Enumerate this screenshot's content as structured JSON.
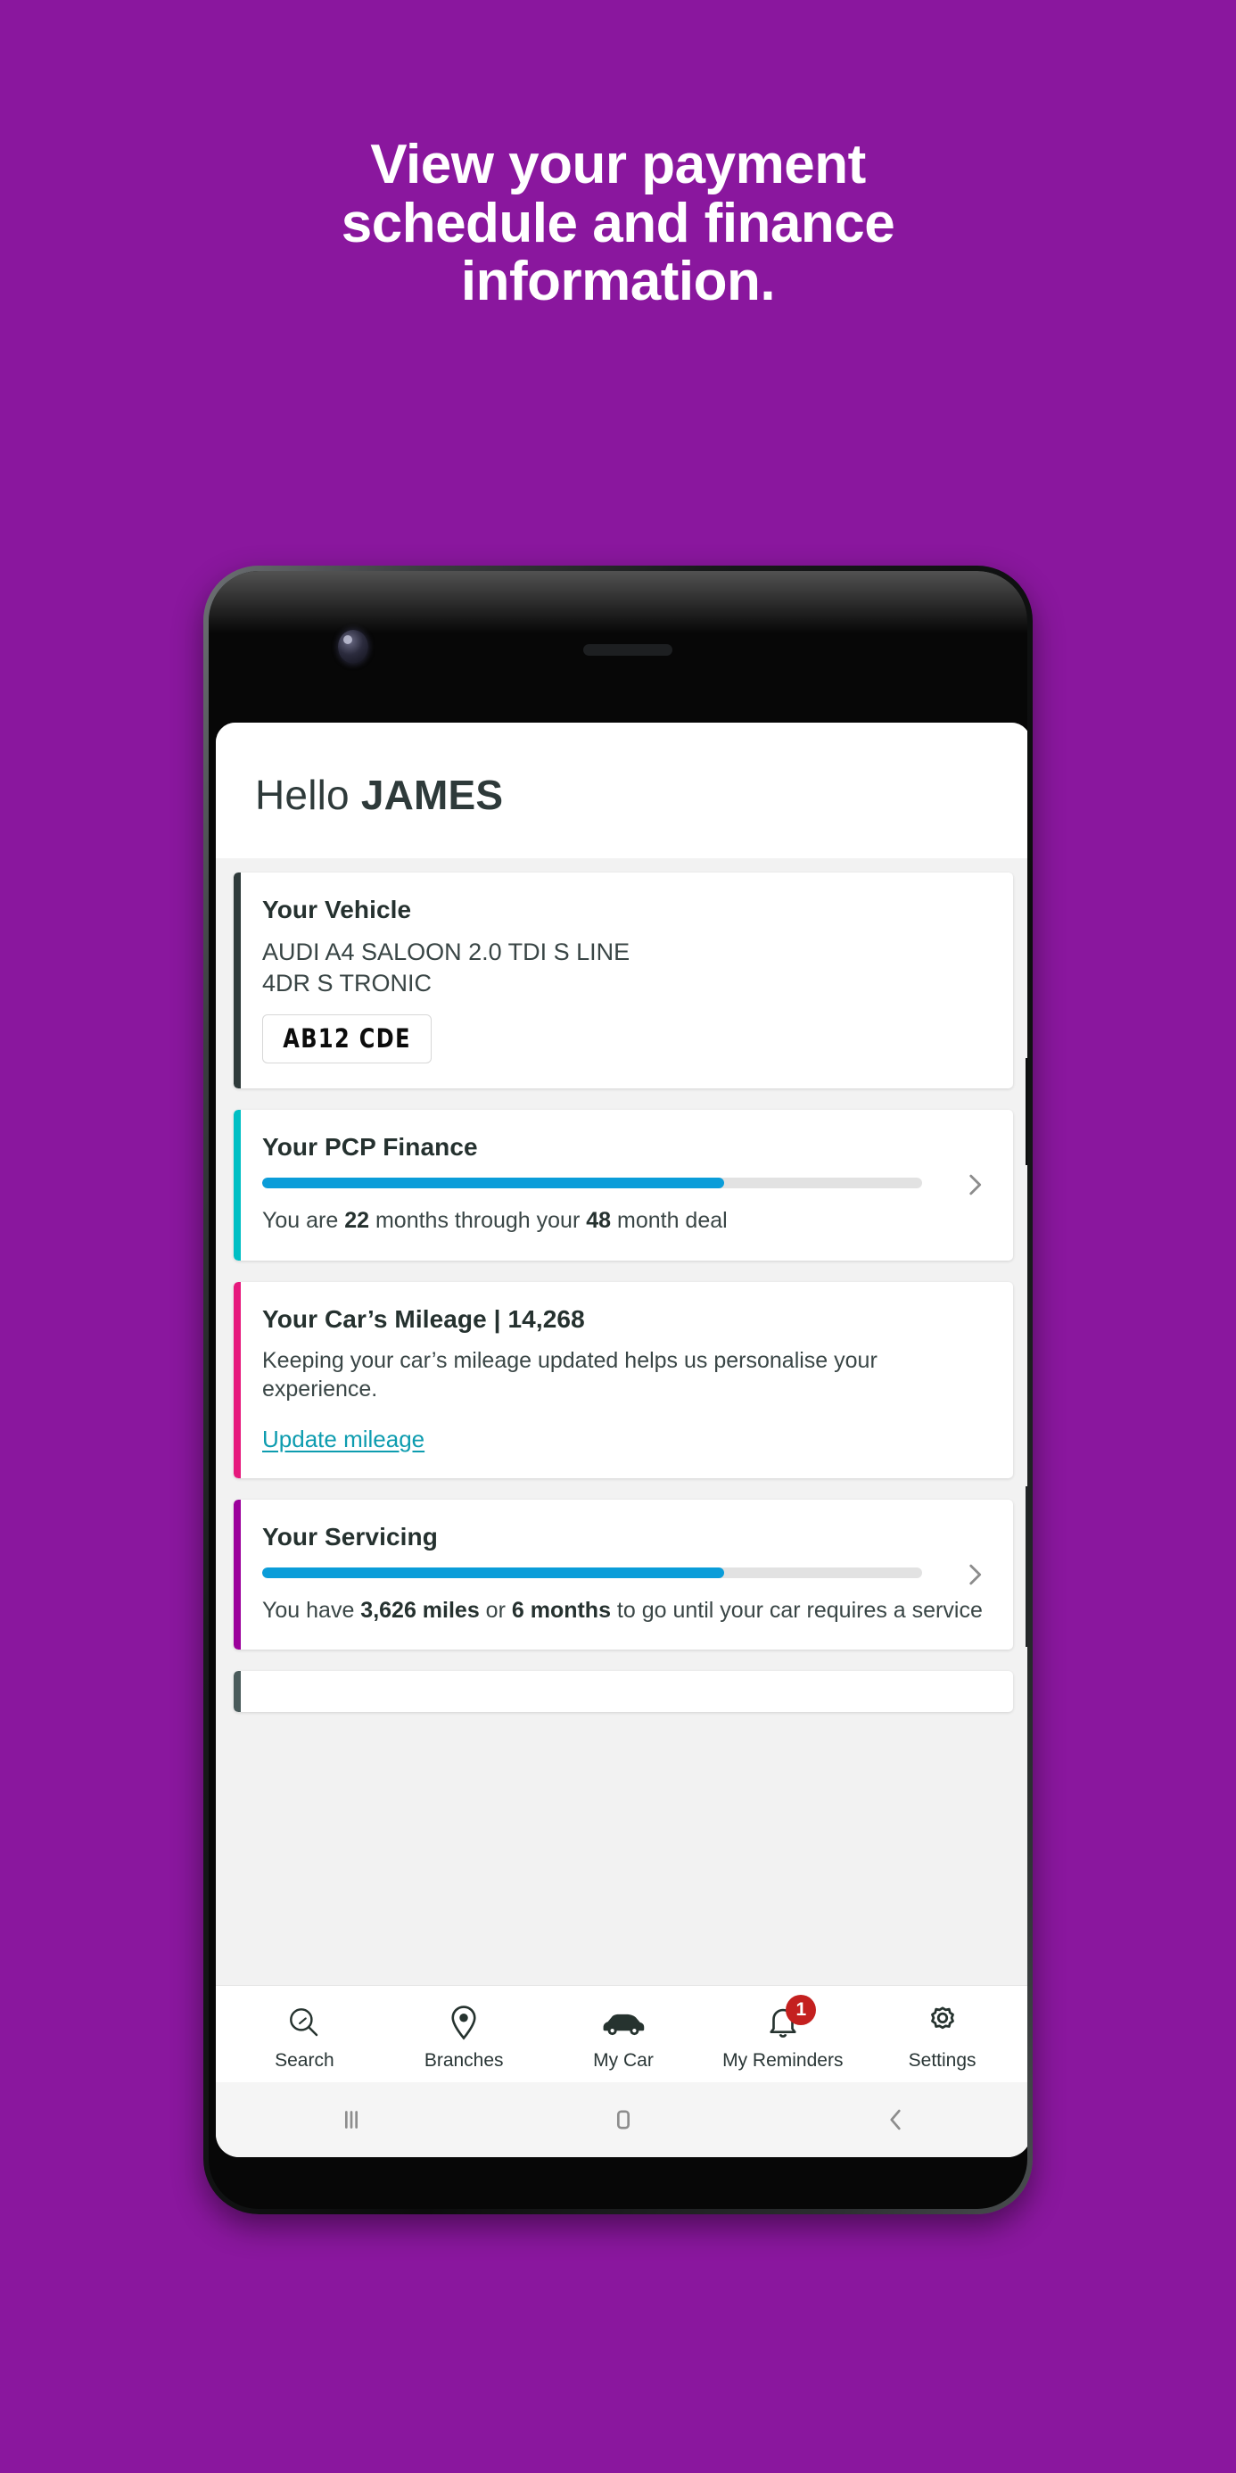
{
  "promo": {
    "headline_lines": [
      "View your payment",
      "schedule and finance",
      "information."
    ],
    "background_color": "#8A179E"
  },
  "app": {
    "header": {
      "greeting": "Hello",
      "user_name": "JAMES"
    },
    "cards": [
      {
        "id": "vehicle",
        "title": "Your Vehicle",
        "accent_color": "#2E3A3A",
        "vehicle_line1": "AUDI A4 SALOON 2.0 TDI S LINE",
        "vehicle_line2": "4DR S TRONIC",
        "registration": "AB12 CDE"
      },
      {
        "id": "finance",
        "title": "Your PCP Finance",
        "accent_color": "#00BFC4",
        "progress_percent": 70,
        "progress_color": "#0B9DD9",
        "body_prefix": "You are ",
        "body_value1": "22",
        "body_middle": " months through your ",
        "body_value2": "48",
        "body_suffix": " month deal",
        "chevron": "chevron-right-icon"
      },
      {
        "id": "mileage",
        "title": "Your Car’s Mileage | 14,268",
        "accent_color": "#E6197D",
        "mileage_value": "14,268",
        "body": "Keeping your car’s mileage updated helps us personalise your experience.",
        "link_label": "Update mileage",
        "link_color": "#0D9CAF"
      },
      {
        "id": "servicing",
        "title": "Your Servicing",
        "accent_color": "#9B009B",
        "progress_percent": 70,
        "progress_color": "#0B9DD9",
        "body_prefix": "You have ",
        "body_value1": "3,626 miles",
        "body_middle": " or ",
        "body_value2": "6 months",
        "body_suffix": " to go until your car requires a service",
        "chevron": "chevron-right-icon"
      },
      {
        "id": "partial",
        "title": "",
        "accent_color": "#4A5B5B"
      }
    ],
    "tabs": [
      {
        "label": "Search",
        "icon": "search-icon"
      },
      {
        "label": "Branches",
        "icon": "map-pin-icon"
      },
      {
        "label": "My Car",
        "icon": "car-icon"
      },
      {
        "label": "My Reminders",
        "icon": "bell-icon",
        "badge": "1",
        "badge_color": "#C4201F"
      },
      {
        "label": "Settings",
        "icon": "gear-icon"
      }
    ]
  },
  "system_nav": {
    "recents": "recents-icon",
    "home": "home-icon",
    "back": "back-icon"
  }
}
